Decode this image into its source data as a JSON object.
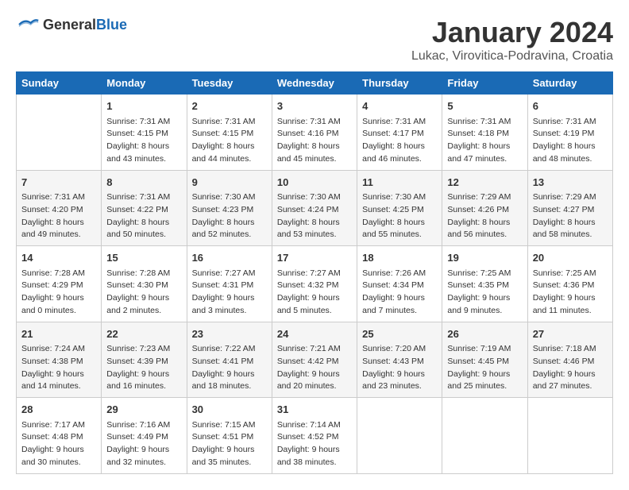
{
  "header": {
    "logo_general": "General",
    "logo_blue": "Blue",
    "month_year": "January 2024",
    "location": "Lukac, Virovitica-Podravina, Croatia"
  },
  "days_of_week": [
    "Sunday",
    "Monday",
    "Tuesday",
    "Wednesday",
    "Thursday",
    "Friday",
    "Saturday"
  ],
  "weeks": [
    [
      {
        "day": "",
        "content": ""
      },
      {
        "day": "1",
        "content": "Sunrise: 7:31 AM\nSunset: 4:15 PM\nDaylight: 8 hours\nand 43 minutes."
      },
      {
        "day": "2",
        "content": "Sunrise: 7:31 AM\nSunset: 4:15 PM\nDaylight: 8 hours\nand 44 minutes."
      },
      {
        "day": "3",
        "content": "Sunrise: 7:31 AM\nSunset: 4:16 PM\nDaylight: 8 hours\nand 45 minutes."
      },
      {
        "day": "4",
        "content": "Sunrise: 7:31 AM\nSunset: 4:17 PM\nDaylight: 8 hours\nand 46 minutes."
      },
      {
        "day": "5",
        "content": "Sunrise: 7:31 AM\nSunset: 4:18 PM\nDaylight: 8 hours\nand 47 minutes."
      },
      {
        "day": "6",
        "content": "Sunrise: 7:31 AM\nSunset: 4:19 PM\nDaylight: 8 hours\nand 48 minutes."
      }
    ],
    [
      {
        "day": "7",
        "content": "Sunrise: 7:31 AM\nSunset: 4:20 PM\nDaylight: 8 hours\nand 49 minutes."
      },
      {
        "day": "8",
        "content": "Sunrise: 7:31 AM\nSunset: 4:22 PM\nDaylight: 8 hours\nand 50 minutes."
      },
      {
        "day": "9",
        "content": "Sunrise: 7:30 AM\nSunset: 4:23 PM\nDaylight: 8 hours\nand 52 minutes."
      },
      {
        "day": "10",
        "content": "Sunrise: 7:30 AM\nSunset: 4:24 PM\nDaylight: 8 hours\nand 53 minutes."
      },
      {
        "day": "11",
        "content": "Sunrise: 7:30 AM\nSunset: 4:25 PM\nDaylight: 8 hours\nand 55 minutes."
      },
      {
        "day": "12",
        "content": "Sunrise: 7:29 AM\nSunset: 4:26 PM\nDaylight: 8 hours\nand 56 minutes."
      },
      {
        "day": "13",
        "content": "Sunrise: 7:29 AM\nSunset: 4:27 PM\nDaylight: 8 hours\nand 58 minutes."
      }
    ],
    [
      {
        "day": "14",
        "content": "Sunrise: 7:28 AM\nSunset: 4:29 PM\nDaylight: 9 hours\nand 0 minutes."
      },
      {
        "day": "15",
        "content": "Sunrise: 7:28 AM\nSunset: 4:30 PM\nDaylight: 9 hours\nand 2 minutes."
      },
      {
        "day": "16",
        "content": "Sunrise: 7:27 AM\nSunset: 4:31 PM\nDaylight: 9 hours\nand 3 minutes."
      },
      {
        "day": "17",
        "content": "Sunrise: 7:27 AM\nSunset: 4:32 PM\nDaylight: 9 hours\nand 5 minutes."
      },
      {
        "day": "18",
        "content": "Sunrise: 7:26 AM\nSunset: 4:34 PM\nDaylight: 9 hours\nand 7 minutes."
      },
      {
        "day": "19",
        "content": "Sunrise: 7:25 AM\nSunset: 4:35 PM\nDaylight: 9 hours\nand 9 minutes."
      },
      {
        "day": "20",
        "content": "Sunrise: 7:25 AM\nSunset: 4:36 PM\nDaylight: 9 hours\nand 11 minutes."
      }
    ],
    [
      {
        "day": "21",
        "content": "Sunrise: 7:24 AM\nSunset: 4:38 PM\nDaylight: 9 hours\nand 14 minutes."
      },
      {
        "day": "22",
        "content": "Sunrise: 7:23 AM\nSunset: 4:39 PM\nDaylight: 9 hours\nand 16 minutes."
      },
      {
        "day": "23",
        "content": "Sunrise: 7:22 AM\nSunset: 4:41 PM\nDaylight: 9 hours\nand 18 minutes."
      },
      {
        "day": "24",
        "content": "Sunrise: 7:21 AM\nSunset: 4:42 PM\nDaylight: 9 hours\nand 20 minutes."
      },
      {
        "day": "25",
        "content": "Sunrise: 7:20 AM\nSunset: 4:43 PM\nDaylight: 9 hours\nand 23 minutes."
      },
      {
        "day": "26",
        "content": "Sunrise: 7:19 AM\nSunset: 4:45 PM\nDaylight: 9 hours\nand 25 minutes."
      },
      {
        "day": "27",
        "content": "Sunrise: 7:18 AM\nSunset: 4:46 PM\nDaylight: 9 hours\nand 27 minutes."
      }
    ],
    [
      {
        "day": "28",
        "content": "Sunrise: 7:17 AM\nSunset: 4:48 PM\nDaylight: 9 hours\nand 30 minutes."
      },
      {
        "day": "29",
        "content": "Sunrise: 7:16 AM\nSunset: 4:49 PM\nDaylight: 9 hours\nand 32 minutes."
      },
      {
        "day": "30",
        "content": "Sunrise: 7:15 AM\nSunset: 4:51 PM\nDaylight: 9 hours\nand 35 minutes."
      },
      {
        "day": "31",
        "content": "Sunrise: 7:14 AM\nSunset: 4:52 PM\nDaylight: 9 hours\nand 38 minutes."
      },
      {
        "day": "",
        "content": ""
      },
      {
        "day": "",
        "content": ""
      },
      {
        "day": "",
        "content": ""
      }
    ]
  ]
}
